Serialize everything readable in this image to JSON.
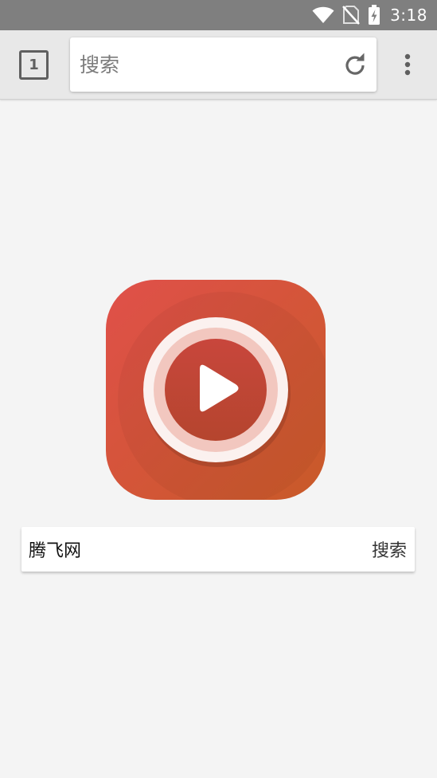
{
  "status_bar": {
    "time": "3:18",
    "icons": [
      "wifi-icon",
      "no-sim-icon",
      "battery-charging-icon"
    ]
  },
  "toolbar": {
    "tab_count": "1",
    "address_placeholder": "搜索",
    "icons": [
      "reload-icon",
      "more-vert-icon"
    ]
  },
  "app": {
    "logo_icon": "play-button-logo-icon",
    "colors": {
      "logo_top": "#e0504a",
      "logo_bottom": "#c85a28",
      "ring": "#f6dcd6"
    }
  },
  "search_card": {
    "input_value": "腾飞网",
    "button_label": "搜索"
  },
  "colors": {
    "status_bar": "#7f7f7f",
    "toolbar": "#e8e8e8",
    "background": "#f4f4f4"
  }
}
